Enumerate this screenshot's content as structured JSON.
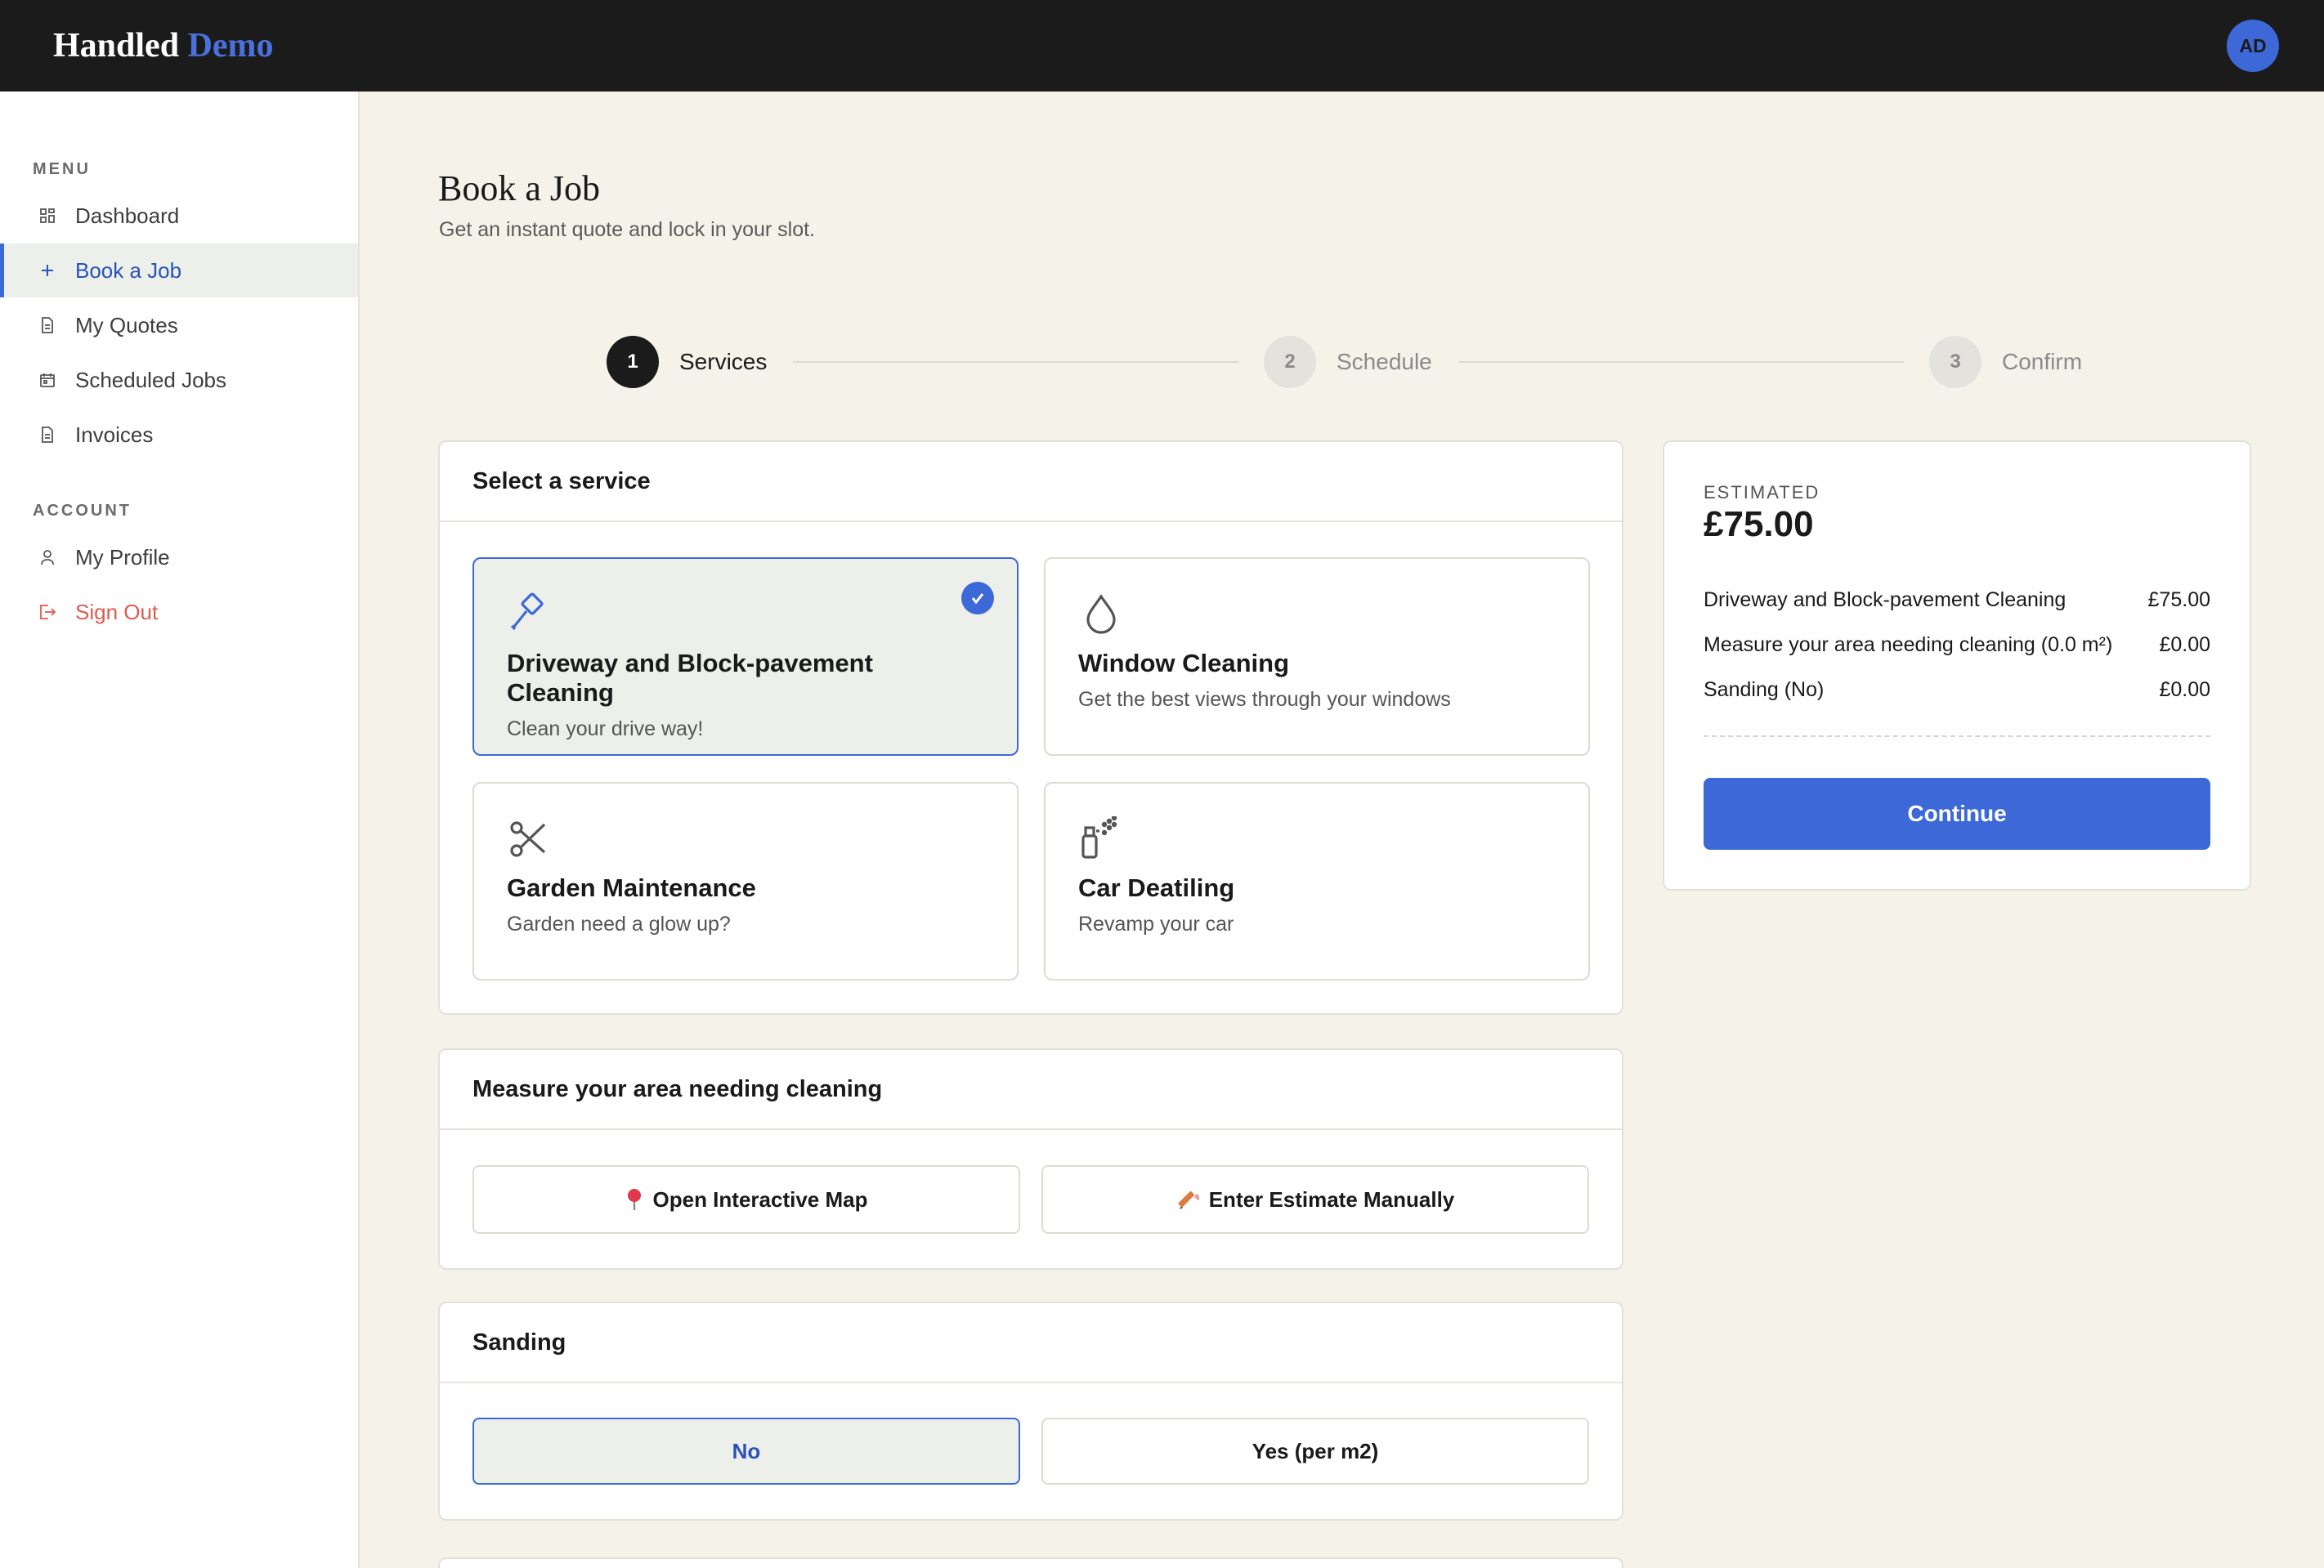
{
  "header": {
    "brand_main": "Handled",
    "brand_accent": "Demo",
    "avatar_initials": "AD"
  },
  "sidebar": {
    "menu_label": "MENU",
    "menu_items": [
      {
        "label": "Dashboard",
        "icon": "grid-icon"
      },
      {
        "label": "Book a Job",
        "icon": "plus-icon",
        "active": true
      },
      {
        "label": "My Quotes",
        "icon": "document-icon"
      },
      {
        "label": "Scheduled Jobs",
        "icon": "calendar-icon"
      },
      {
        "label": "Invoices",
        "icon": "document-icon"
      }
    ],
    "account_label": "ACCOUNT",
    "account_items": [
      {
        "label": "My Profile",
        "icon": "user-icon"
      },
      {
        "label": "Sign Out",
        "icon": "sign-out-icon"
      }
    ]
  },
  "page": {
    "title": "Book a Job",
    "subtitle": "Get an instant quote and lock in your slot."
  },
  "stepper": {
    "steps": [
      {
        "number": "1",
        "label": "Services",
        "state": "current"
      },
      {
        "number": "2",
        "label": "Schedule",
        "state": "upcoming"
      },
      {
        "number": "3",
        "label": "Confirm",
        "state": "upcoming"
      }
    ]
  },
  "services": {
    "header": "Select a service",
    "items": [
      {
        "title": "Driveway and Block-pavement Cleaning",
        "desc": "Clean your drive way!",
        "icon": "hammer-icon",
        "selected": true
      },
      {
        "title": "Window Cleaning",
        "desc": "Get the best views through your windows",
        "icon": "water-drop-icon",
        "selected": false
      },
      {
        "title": "Garden Maintenance",
        "desc": "Garden need a glow up?",
        "icon": "scissors-icon",
        "selected": false
      },
      {
        "title": "Car Deatiling",
        "desc": "Revamp your car",
        "icon": "spray-bottle-icon",
        "selected": false
      }
    ]
  },
  "measure": {
    "header": "Measure your area needing cleaning",
    "map_button": "Open Interactive Map",
    "manual_button": "Enter Estimate Manually"
  },
  "sanding": {
    "header": "Sanding",
    "options": [
      "No",
      "Yes (per m2)"
    ],
    "selected": "No"
  },
  "summary": {
    "estimated_label": "ESTIMATED",
    "total": "£75.00",
    "lines": [
      {
        "label": "Driveway and Block-pavement Cleaning",
        "amount": "£75.00"
      },
      {
        "label": "Measure your area needing cleaning (0.0 m²)",
        "amount": "£0.00"
      },
      {
        "label": "Sanding (No)",
        "amount": "£0.00"
      }
    ],
    "continue_label": "Continue"
  },
  "colors": {
    "accent": "#3d69d8",
    "topbar": "#1b1b1b",
    "background": "#f5f2ea",
    "danger": "#e05a4e"
  }
}
